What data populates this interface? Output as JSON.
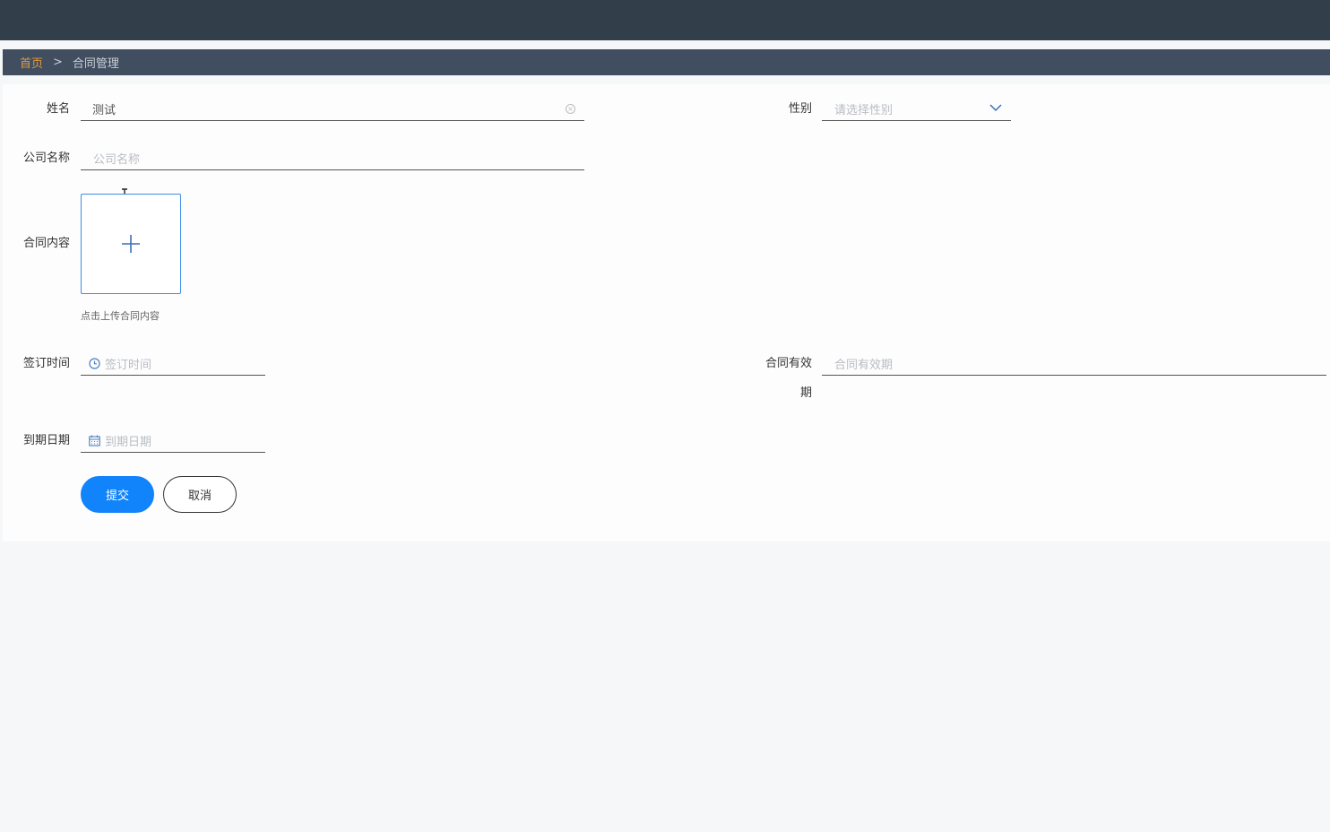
{
  "breadcrumb": {
    "home": "首页",
    "separator": ">",
    "current": "合同管理"
  },
  "form": {
    "name": {
      "label": "姓名",
      "value": "测试"
    },
    "gender": {
      "label": "性别",
      "placeholder": "请选择性别"
    },
    "company": {
      "label": "公司名称",
      "placeholder": "公司名称"
    },
    "contract": {
      "label": "合同内容",
      "upload_tip": "点击上传合同内容"
    },
    "sign_time": {
      "label": "签订时间",
      "placeholder": "签订时间"
    },
    "validity": {
      "label_line1": "合同有效",
      "label_line2": "期",
      "placeholder": "合同有效期"
    },
    "expire": {
      "label": "到期日期",
      "placeholder": "到期日期"
    },
    "submit_label": "提交",
    "cancel_label": "取消"
  },
  "colors": {
    "topbar": "#333e4b",
    "breadcrumb_bar": "#414e60",
    "home_link": "#e39a3d",
    "primary": "#1183fb",
    "upload_border": "#3a8ee6"
  }
}
